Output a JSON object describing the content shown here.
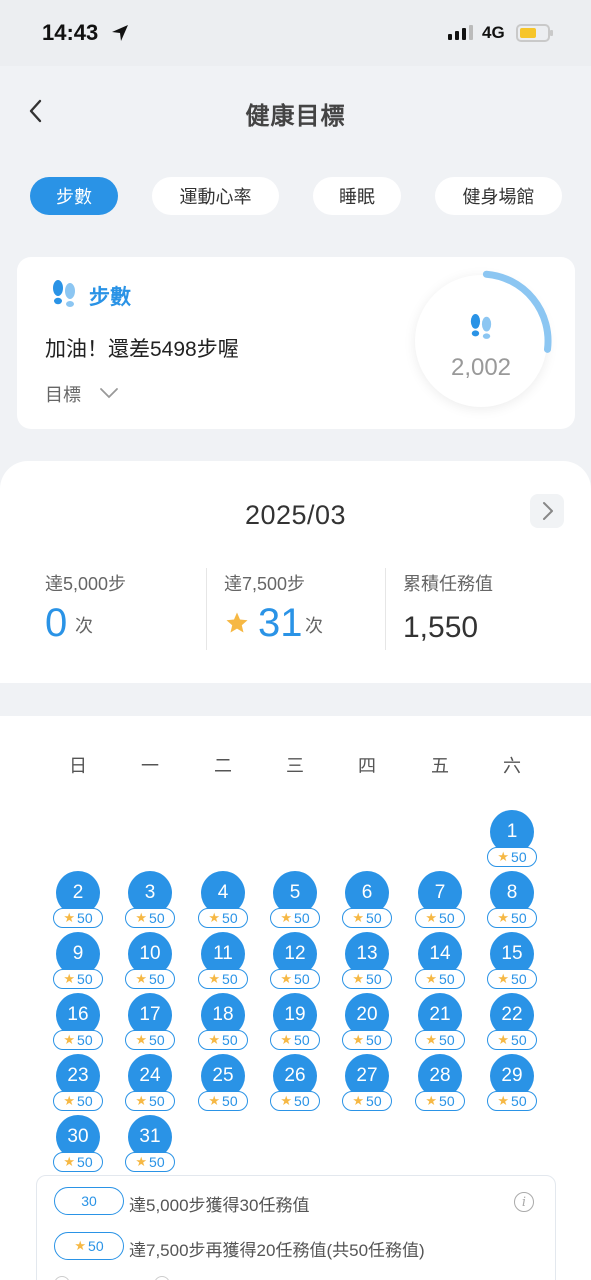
{
  "status": {
    "time": "14:43",
    "network": "4G"
  },
  "nav": {
    "title": "健康目標"
  },
  "tabs": [
    {
      "label": "步數",
      "active": true
    },
    {
      "label": "運動心率",
      "active": false
    },
    {
      "label": "睡眠",
      "active": false
    },
    {
      "label": "健身場館",
      "active": false
    }
  ],
  "steps_card": {
    "label": "步數",
    "message": "加油！還差5498步喔",
    "goal_label": "目標",
    "current_steps": "2,002",
    "ring_progress": 0.27
  },
  "month": {
    "title": "2025/03",
    "stats": [
      {
        "label": "達5,000步",
        "value": "0",
        "unit": "次"
      },
      {
        "label": "達7,500步",
        "value": "31",
        "unit": "次"
      },
      {
        "label": "累積任務值",
        "value": "1,550"
      }
    ]
  },
  "calendar": {
    "weekdays": [
      "日",
      "一",
      "二",
      "三",
      "四",
      "五",
      "六"
    ],
    "first_weekday_index": 6,
    "days": [
      {
        "day": "1",
        "reward": "50"
      },
      {
        "day": "2",
        "reward": "50"
      },
      {
        "day": "3",
        "reward": "50"
      },
      {
        "day": "4",
        "reward": "50"
      },
      {
        "day": "5",
        "reward": "50"
      },
      {
        "day": "6",
        "reward": "50"
      },
      {
        "day": "7",
        "reward": "50"
      },
      {
        "day": "8",
        "reward": "50"
      },
      {
        "day": "9",
        "reward": "50"
      },
      {
        "day": "10",
        "reward": "50"
      },
      {
        "day": "11",
        "reward": "50"
      },
      {
        "day": "12",
        "reward": "50"
      },
      {
        "day": "13",
        "reward": "50"
      },
      {
        "day": "14",
        "reward": "50"
      },
      {
        "day": "15",
        "reward": "50"
      },
      {
        "day": "16",
        "reward": "50"
      },
      {
        "day": "17",
        "reward": "50"
      },
      {
        "day": "18",
        "reward": "50"
      },
      {
        "day": "19",
        "reward": "50"
      },
      {
        "day": "20",
        "reward": "50"
      },
      {
        "day": "21",
        "reward": "50"
      },
      {
        "day": "22",
        "reward": "50"
      },
      {
        "day": "23",
        "reward": "50"
      },
      {
        "day": "24",
        "reward": "50"
      },
      {
        "day": "25",
        "reward": "50"
      },
      {
        "day": "26",
        "reward": "50"
      },
      {
        "day": "27",
        "reward": "50"
      },
      {
        "day": "28",
        "reward": "50"
      },
      {
        "day": "29",
        "reward": "50"
      },
      {
        "day": "30",
        "reward": "50"
      },
      {
        "day": "31",
        "reward": "50"
      }
    ]
  },
  "legend": [
    {
      "pill": "30",
      "star": false,
      "text": "達5,000步獲得30任務值"
    },
    {
      "pill": "50",
      "star": true,
      "text": "達7,500步再獲得20任務值(共50任務值)"
    }
  ],
  "colors": {
    "accent": "#2a93e6",
    "star": "#f6b844",
    "background": "#f0f2f5"
  }
}
